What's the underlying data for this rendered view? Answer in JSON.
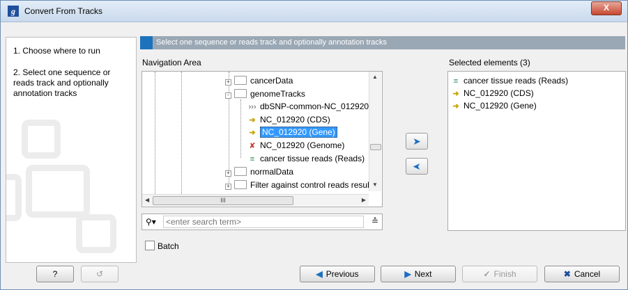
{
  "window": {
    "title": "Convert From Tracks",
    "close_label": "X"
  },
  "steps": [
    {
      "label": "1. Choose where to run"
    },
    {
      "label": "2. Select one sequence or reads track and optionally annotation tracks"
    }
  ],
  "header": {
    "title": "Select one sequence or reads track and optionally annotation tracks"
  },
  "navigation": {
    "label": "Navigation Area",
    "tree": [
      {
        "label": "cancerData",
        "icon": "folder-icon",
        "expander": "+"
      },
      {
        "label": "genomeTracks",
        "icon": "folder-open-icon",
        "expander": "-"
      },
      {
        "label": "dbSNP-common-NC_012920",
        "icon": "variant-track-icon"
      },
      {
        "label": "NC_012920 (CDS)",
        "icon": "annotation-track-icon"
      },
      {
        "label": "NC_012920 (Gene)",
        "icon": "annotation-track-icon",
        "selected": true
      },
      {
        "label": "NC_012920 (Genome)",
        "icon": "sequence-track-icon"
      },
      {
        "label": "cancer tissue reads (Reads)",
        "icon": "reads-track-icon"
      },
      {
        "label": "normalData",
        "icon": "folder-icon",
        "expander": "+"
      },
      {
        "label": "Filter against control reads result",
        "icon": "folder-icon",
        "expander": "+"
      }
    ],
    "scroll_hint": "III",
    "search_placeholder": "<enter search term>"
  },
  "selected": {
    "label": "Selected elements (3)",
    "items": [
      {
        "label": "cancer tissue reads (Reads)",
        "icon": "reads-track-icon"
      },
      {
        "label": "NC_012920 (CDS)",
        "icon": "annotation-track-icon"
      },
      {
        "label": "NC_012920 (Gene)",
        "icon": "annotation-track-icon"
      }
    ]
  },
  "batch": {
    "label": "Batch",
    "checked": false
  },
  "buttons": {
    "help": "?",
    "previous": "Previous",
    "next": "Next",
    "finish": "Finish",
    "cancel": "Cancel"
  }
}
